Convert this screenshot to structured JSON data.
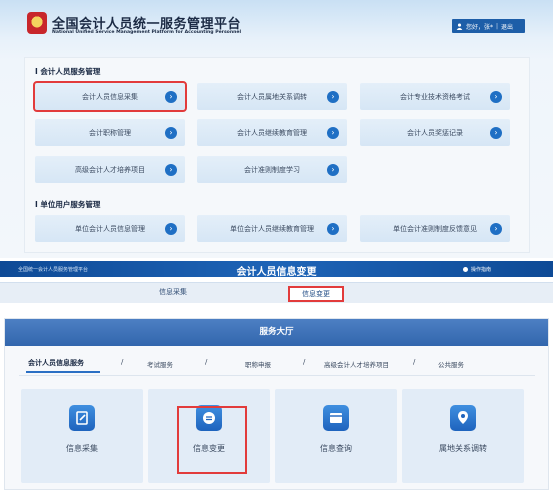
{
  "header": {
    "site_title": "全国会计人员统一服务管理平台",
    "site_subtitle": "National Unified Service Management Platform for Accounting Personnel",
    "user_greeting": "您好，张*",
    "logout": "退出"
  },
  "personal_services": {
    "heading": "I 会计人员服务管理",
    "items": [
      {
        "label": "会计人员信息采集",
        "highlighted": true
      },
      {
        "label": "会计人员属地关系调转"
      },
      {
        "label": "会计专业技术资格考试"
      },
      {
        "label": "会计职称管理"
      },
      {
        "label": "会计人员继续教育管理"
      },
      {
        "label": "会计人员奖惩记录"
      },
      {
        "label": "高级会计人才培养项目"
      },
      {
        "label": "会计准则制度学习"
      }
    ]
  },
  "unit_services": {
    "heading": "I 单位用户服务管理",
    "items": [
      {
        "label": "单位会计人员信息管理"
      },
      {
        "label": "单位会计人员继续教育管理"
      },
      {
        "label": "单位会计准则制度反馈意见"
      }
    ]
  },
  "band": {
    "breadcrumb": "全国统一会计人员服务管理平台",
    "title": "会计人员信息变更",
    "guide": "操作指南",
    "tabs": [
      "信息采集",
      "信息变更"
    ],
    "active_tab": "信息变更"
  },
  "hall": {
    "title": "服务大厅",
    "tabs": [
      "会计人员信息服务",
      "考试服务",
      "职称申报",
      "高级会计人才培养项目",
      "公共服务"
    ],
    "tiles": [
      {
        "label": "信息采集",
        "icon": "edit-icon"
      },
      {
        "label": "信息变更",
        "icon": "swap-icon",
        "highlighted": true
      },
      {
        "label": "信息查询",
        "icon": "card-icon"
      },
      {
        "label": "属地关系调转",
        "icon": "location-icon"
      }
    ]
  },
  "colors": {
    "primary_blue": "#1f6fc4",
    "header_blue": "#1d5ea8",
    "highlight_red": "#e23b3b"
  }
}
